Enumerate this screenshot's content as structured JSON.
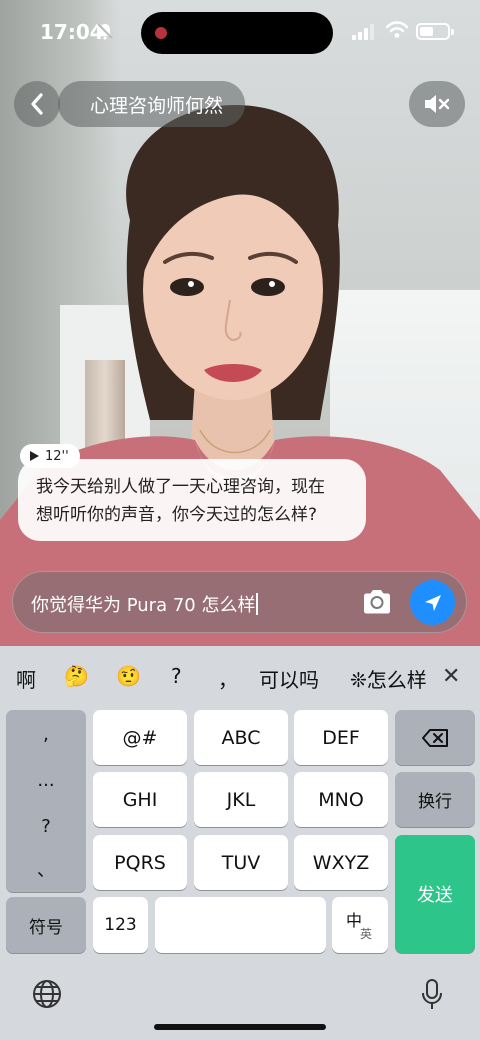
{
  "status_bar": {
    "time": "17:04"
  },
  "header": {
    "title": "心理咨询师何然"
  },
  "voice_message": {
    "duration": "12''"
  },
  "message": {
    "line1": "我今天给别人做了一天心理咨询，现在",
    "line2": "想听听你的声音，你今天过的怎么样?"
  },
  "input": {
    "value": "你觉得华为 Pura 70 怎么样"
  },
  "suggestions": [
    "啊",
    "🤔",
    "🤨",
    "?",
    "，",
    "可以吗",
    "怎么样"
  ],
  "keyboard": {
    "symbols": [
      ",",
      "...",
      "?",
      "、"
    ],
    "row1": [
      "@#",
      "ABC",
      "DEF"
    ],
    "row2": [
      "GHI",
      "JKL",
      "MNO"
    ],
    "row3": [
      "PQRS",
      "TUV",
      "WXYZ"
    ],
    "newline": "换行",
    "send": "发送",
    "symbol_key": "符号",
    "num_key": "123",
    "lang_main": "中",
    "lang_sub": "英"
  },
  "colors": {
    "send_button": "#1f8fff",
    "send_key": "#2dc58a",
    "keyboard_bg": "#d5d8dd"
  }
}
